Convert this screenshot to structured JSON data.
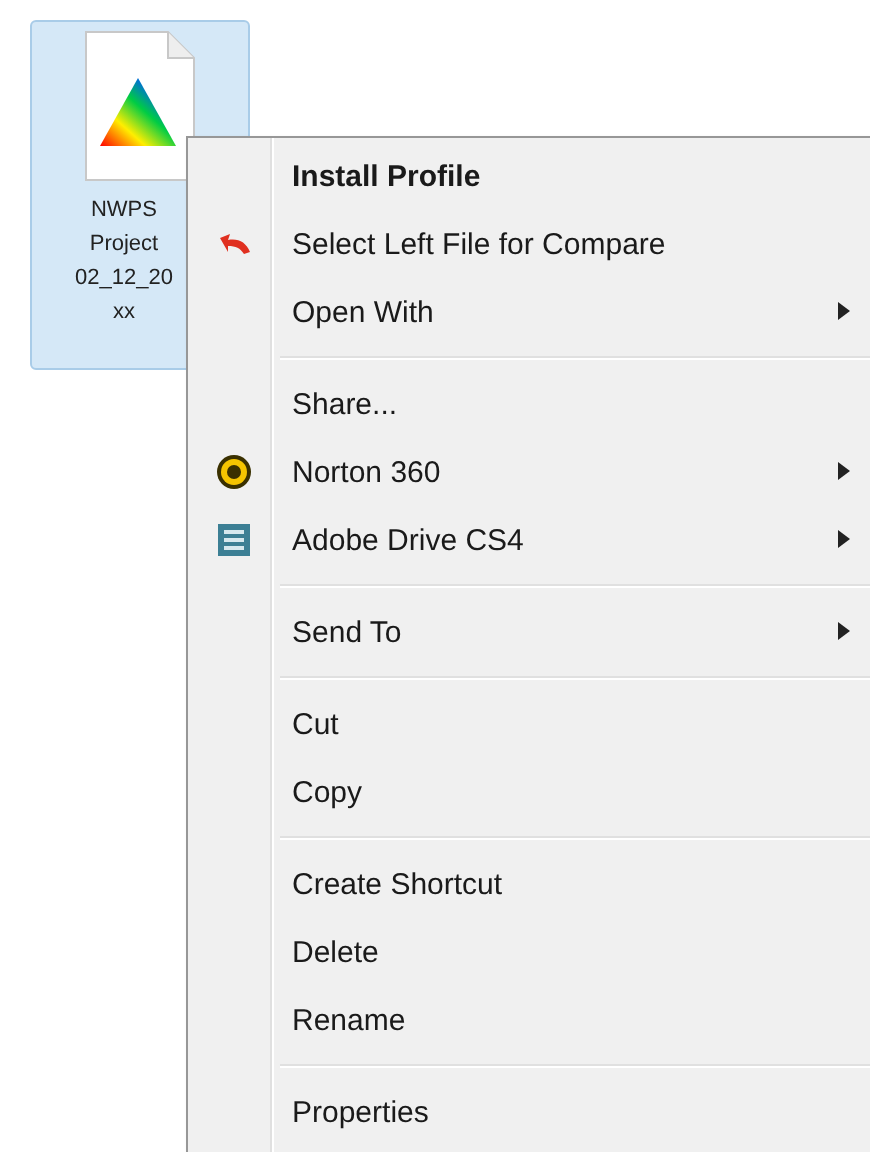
{
  "file": {
    "name_lines": [
      "NWPS",
      "Project",
      "02_12_20",
      "xx"
    ],
    "selected": true
  },
  "context_menu": {
    "groups": [
      {
        "items": [
          {
            "label": "Install Profile",
            "bold": true,
            "submenu": false,
            "kind": "plain"
          },
          {
            "label": "Select Left File for Compare",
            "bold": false,
            "submenu": false,
            "kind": "undo"
          },
          {
            "label": "Open With",
            "bold": false,
            "submenu": true,
            "kind": "plain"
          }
        ]
      },
      {
        "items": [
          {
            "label": "Share...",
            "bold": false,
            "submenu": false,
            "kind": "plain"
          },
          {
            "label": "Norton 360",
            "bold": false,
            "submenu": true,
            "kind": "norton"
          },
          {
            "label": "Adobe Drive CS4",
            "bold": false,
            "submenu": true,
            "kind": "drive"
          }
        ]
      },
      {
        "items": [
          {
            "label": "Send To",
            "bold": false,
            "submenu": true,
            "kind": "plain"
          }
        ]
      },
      {
        "items": [
          {
            "label": "Cut",
            "bold": false,
            "submenu": false,
            "kind": "plain"
          },
          {
            "label": "Copy",
            "bold": false,
            "submenu": false,
            "kind": "plain"
          }
        ]
      },
      {
        "items": [
          {
            "label": "Create Shortcut",
            "bold": false,
            "submenu": false,
            "kind": "plain"
          },
          {
            "label": "Delete",
            "bold": false,
            "submenu": false,
            "kind": "plain"
          },
          {
            "label": "Rename",
            "bold": false,
            "submenu": false,
            "kind": "plain"
          }
        ]
      },
      {
        "items": [
          {
            "label": "Properties",
            "bold": false,
            "submenu": false,
            "kind": "plain"
          }
        ]
      }
    ]
  }
}
